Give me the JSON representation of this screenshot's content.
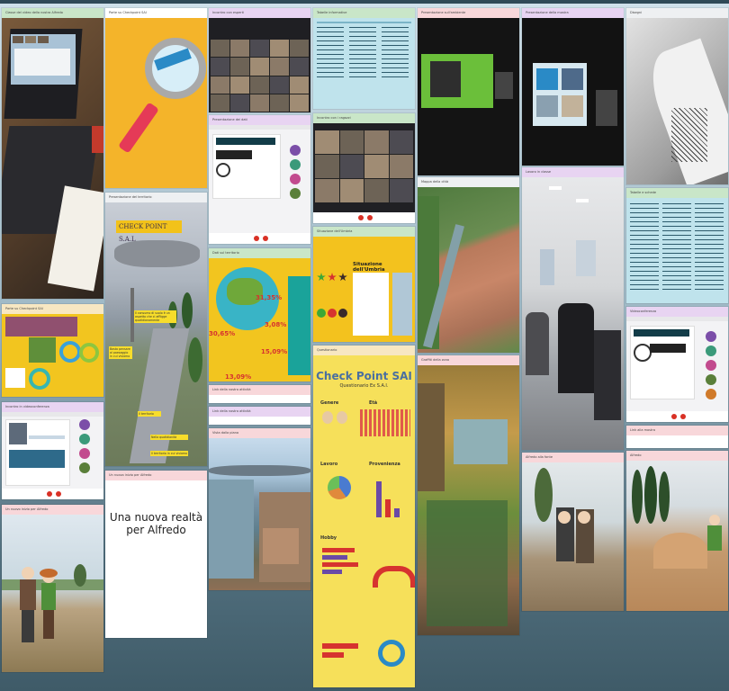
{
  "board": {
    "background_color": "#52707f"
  },
  "cards": {
    "c1": {
      "header": "Classe del video della nostra Alfredo",
      "header_color": "#c9e6c8"
    },
    "c2": {
      "header": "Parte su Checkpoint SAI",
      "header_color": "#f7e7c2"
    },
    "c3": {
      "header": "CHECK POINT S.A.L",
      "banner": "CHECK POINT S.A.L",
      "header_color": "#eef0f2"
    },
    "c4": {
      "header": "Presentazione del territorio",
      "header_color": "#f8d7da",
      "sign1": "Il consumo di suolo è un aspetto che ci affligge quotidianamente",
      "sign2": "Basta pensare al paesaggio in cui viviamo",
      "sign3": "Il territorio",
      "sign4": "Nella quotidianità",
      "sign5": "Il territorio in cui viviamo"
    },
    "c5": {
      "header": "Il territorio in cui viviamo",
      "header_color": "#eef0f2"
    },
    "c6": {
      "header": "Incontro in videoconferenza",
      "header_color": "#e8d4f2"
    },
    "c7": {
      "header": "Un nuovo inizio per Alfredo",
      "header_color": "#f8d7da",
      "note": "Una nuova realtà per Alfredo"
    },
    "c8": {
      "header": "Incontro con esperti",
      "header_color": "#e8d4f2"
    },
    "c9": {
      "header": "Presentazione dei dati",
      "header_color": "#e8d4f2"
    },
    "c10": {
      "header": "Dati sul territorio",
      "header_color": "#c9e6c8",
      "p1": "31,35%",
      "p2": "30,65%",
      "p3": "3,08%",
      "p4": "15,09%",
      "p5": "13,09%"
    },
    "c11": {
      "header": "Link della nostra attività",
      "header_color": "#f8d7da"
    },
    "c12": {
      "header": "Link della nostra attività",
      "header_color": "#e8d4f2"
    },
    "c13": {
      "header": "Vista dalla piana",
      "header_color": "#f8d7da"
    },
    "c14": {
      "header": "Tabelle informative",
      "header_color": "#c9e6c8"
    },
    "c15": {
      "header": "Incontro con i ragazzi",
      "header_color": "#c9e6c8"
    },
    "c16": {
      "header": "Situazione dell'Umbria",
      "header_color": "#c9e6c8",
      "label": "Situazione dell'Umbria"
    },
    "c17": {
      "header": "Questionario",
      "header_color": "#f7e7c2",
      "title": "Check Point SAI",
      "subtitle": "Questionario Ex S.A.I.",
      "l_genere": "Genere",
      "l_eta": "Età",
      "l_lavoro": "Lavoro",
      "l_provenienza": "Provenienza",
      "l_hobby": "Hobby"
    },
    "c18": {
      "header": "Presentazione sull'ambiente",
      "header_color": "#f8d7da"
    },
    "c19": {
      "header": "Mappa della città",
      "header_color": "#eef0f2"
    },
    "c20": {
      "header": "Graffiti della zona",
      "header_color": "#f8d7da"
    },
    "c21": {
      "header": "Presentazione della mostra",
      "header_color": "#e8d4f2"
    },
    "c22": {
      "header": "Lavoro in classe",
      "header_color": "#eef0f2"
    },
    "c23": {
      "header": "Alfredo alla fonte",
      "header_color": "#f8d7da"
    },
    "c24": {
      "header": "Vista dall'alto",
      "header_color": "#c9e6c8"
    },
    "c25": {
      "header": "Disegni",
      "header_color": "#eef0f2"
    },
    "c26": {
      "header": "Tabelle e schede",
      "header_color": "#c9e6c8"
    },
    "c27": {
      "header": "Videoconferenza",
      "header_color": "#e8d4f2"
    },
    "c28": {
      "header": "Link alla mostra",
      "header_color": "#f8d7da"
    },
    "c29": {
      "header": "Alfredo",
      "header_color": "#f8d7da"
    }
  }
}
